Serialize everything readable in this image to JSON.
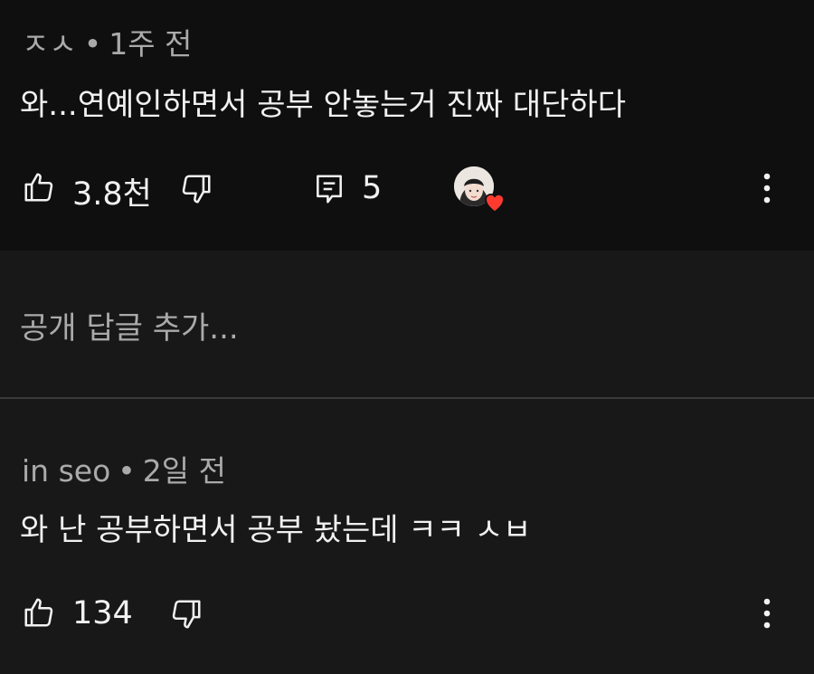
{
  "comments": [
    {
      "author": "ㅈㅅ",
      "time": "1주 전",
      "text": "와...연예인하면서 공부 안놓는거 진짜 대단하다",
      "likes": "3.8천",
      "replies": "5",
      "has_creator_heart": true
    },
    {
      "author": "in seo",
      "time": "2일 전",
      "text": "와 난 공부하면서 공부 놨는데 ㅋㅋ ㅅㅂ",
      "likes": "134"
    }
  ],
  "reply_input": {
    "placeholder": "공개 답글 추가..."
  },
  "separator": "•",
  "colors": {
    "background": "#181818",
    "highlight": "#0f0f0f",
    "heart": "#ff3b30",
    "meta_text": "#aaaaaa"
  },
  "icons": [
    "thumbs-up-icon",
    "thumbs-down-icon",
    "reply-icon",
    "more-vert-icon",
    "heart-icon"
  ]
}
